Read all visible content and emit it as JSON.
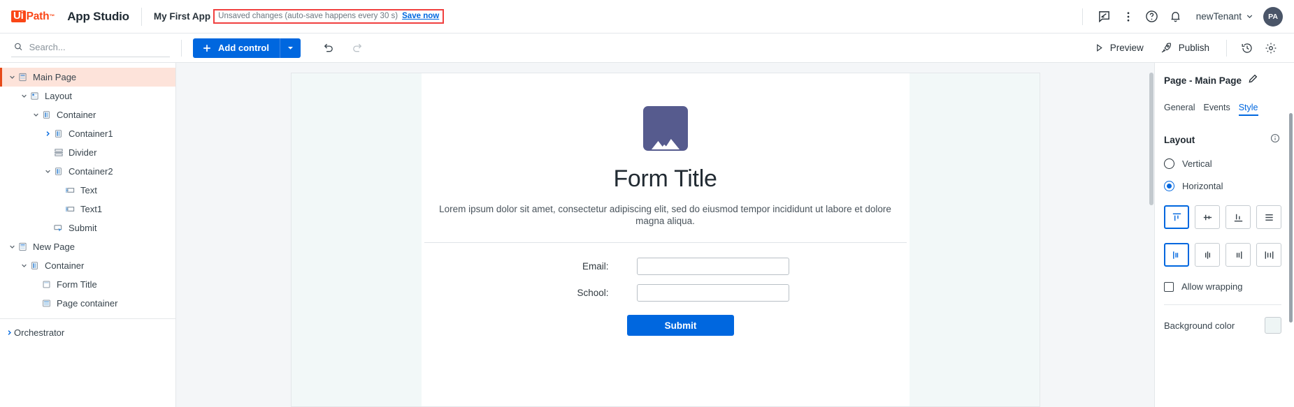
{
  "header": {
    "logo_ui": "Ui",
    "logo_path": "Path",
    "product": "App Studio",
    "app_name": "My First App",
    "unsaved_text": "Unsaved changes (auto-save happens every 30 s)",
    "save_now": "Save now",
    "tenant": "newTenant",
    "avatar_initials": "PA",
    "icons": [
      "feedback-icon",
      "more-vertical-icon",
      "help-circle-icon",
      "bell-icon"
    ],
    "accent_red": "#fa4616",
    "alert_border": "#f0403f",
    "link_blue": "#0067df"
  },
  "toolbar": {
    "search_placeholder": "Search...",
    "search_value": "",
    "add_control": "Add control",
    "undo": "undo-icon",
    "redo": "redo-icon",
    "preview": "Preview",
    "publish": "Publish",
    "history": "history-icon",
    "settings": "settings-gear-icon"
  },
  "tree": {
    "items": [
      {
        "label": "Main Page",
        "indent": 0,
        "caret": "down",
        "icon": "page-icon",
        "selected": true
      },
      {
        "label": "Layout",
        "indent": 1,
        "caret": "down",
        "icon": "layout-icon",
        "selected": false
      },
      {
        "label": "Container",
        "indent": 2,
        "caret": "down",
        "icon": "container-icon",
        "selected": false
      },
      {
        "label": "Container1",
        "indent": 3,
        "caret": "right",
        "icon": "container-icon",
        "selected": false
      },
      {
        "label": "Divider",
        "indent": 3,
        "caret": "none",
        "icon": "divider-icon",
        "selected": false
      },
      {
        "label": "Container2",
        "indent": 3,
        "caret": "down",
        "icon": "container-icon",
        "selected": false
      },
      {
        "label": "Text",
        "indent": 4,
        "caret": "none",
        "icon": "text-icon",
        "selected": false
      },
      {
        "label": "Text1",
        "indent": 4,
        "caret": "none",
        "icon": "text-icon",
        "selected": false
      },
      {
        "label": "Submit",
        "indent": 3,
        "caret": "none",
        "icon": "button-icon",
        "selected": false
      },
      {
        "label": "New Page",
        "indent": 0,
        "caret": "down",
        "icon": "page-icon",
        "selected": false
      },
      {
        "label": "Container",
        "indent": 1,
        "caret": "down",
        "icon": "container-icon",
        "selected": false
      },
      {
        "label": "Form Title",
        "indent": 2,
        "caret": "none",
        "icon": "label-icon",
        "selected": false
      },
      {
        "label": "Page container",
        "indent": 2,
        "caret": "none",
        "icon": "pagecont-icon",
        "selected": false
      }
    ],
    "orchestrator": "Orchestrator",
    "selected_bg": "#fde3da",
    "selected_bar": "#e64a19"
  },
  "canvas": {
    "image_placeholder": "image-placeholder-icon",
    "image_color": "#565b8e",
    "form_title": "Form Title",
    "form_subtitle": "Lorem ipsum dolor sit amet, consectetur adipiscing elit, sed do eiusmod tempor incididunt ut labore et dolore magna aliqua.",
    "fields": [
      {
        "label": "Email:",
        "value": ""
      },
      {
        "label": "School:",
        "value": ""
      }
    ],
    "submit_label": "Submit",
    "submit_color": "#0067df",
    "side_color": "#f2f8f8"
  },
  "properties": {
    "title": "Page - Main Page",
    "edit_icon": "pencil-icon",
    "tabs": [
      {
        "label": "General",
        "active": false
      },
      {
        "label": "Events",
        "active": false
      },
      {
        "label": "Style",
        "active": true
      }
    ],
    "layout_section": "Layout",
    "info_icon": "info-icon",
    "orientation": [
      {
        "label": "Vertical",
        "checked": false
      },
      {
        "label": "Horizontal",
        "checked": true
      }
    ],
    "align_main": [
      {
        "name": "align-start-icon",
        "active": true
      },
      {
        "name": "align-center-icon",
        "active": false
      },
      {
        "name": "align-end-icon",
        "active": false
      },
      {
        "name": "align-stretch-icon",
        "active": false
      }
    ],
    "align_cross": [
      {
        "name": "justify-start-icon",
        "active": true
      },
      {
        "name": "justify-center-icon",
        "active": false
      },
      {
        "name": "justify-end-icon",
        "active": false
      },
      {
        "name": "justify-between-icon",
        "active": false
      }
    ],
    "allow_wrapping": "Allow wrapping",
    "allow_wrapping_checked": false,
    "background_color_label": "Background color",
    "background_color_value": "#eef5f5",
    "accent": "#0067df"
  }
}
